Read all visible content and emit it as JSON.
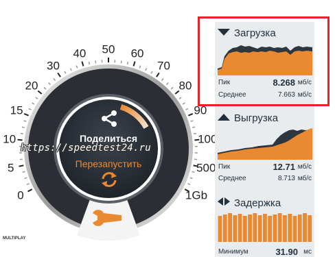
{
  "gauge": {
    "ticks": [
      "0",
      "5",
      "10",
      "15",
      "20",
      "30",
      "40",
      "50",
      "60",
      "70",
      "80",
      "90",
      "100",
      "500",
      "1Gb"
    ],
    "share_label": "Поделиться",
    "restart_label": "Перезапустить",
    "watermark": "https://speedtest24.ru",
    "logo": "MULTIPLAY"
  },
  "download": {
    "title": "Загрузка",
    "peak_label": "Пик",
    "peak_value": "8.268",
    "peak_unit": "мб/с",
    "avg_label": "Среднее",
    "avg_value": "7.663",
    "avg_unit": "мб/с"
  },
  "upload": {
    "title": "Выгрузка",
    "peak_label": "Пик",
    "peak_value": "12.71",
    "peak_unit": "мб/с",
    "avg_label": "Среднее",
    "avg_value": "8.713",
    "avg_unit": "мб/с"
  },
  "latency": {
    "title": "Задержка",
    "min_label": "Минимум",
    "min_value": "31.90",
    "min_unit": "мс"
  },
  "colors": {
    "accent": "#e98a33",
    "dark": "#2e3640",
    "highlight": "#e0262b"
  }
}
